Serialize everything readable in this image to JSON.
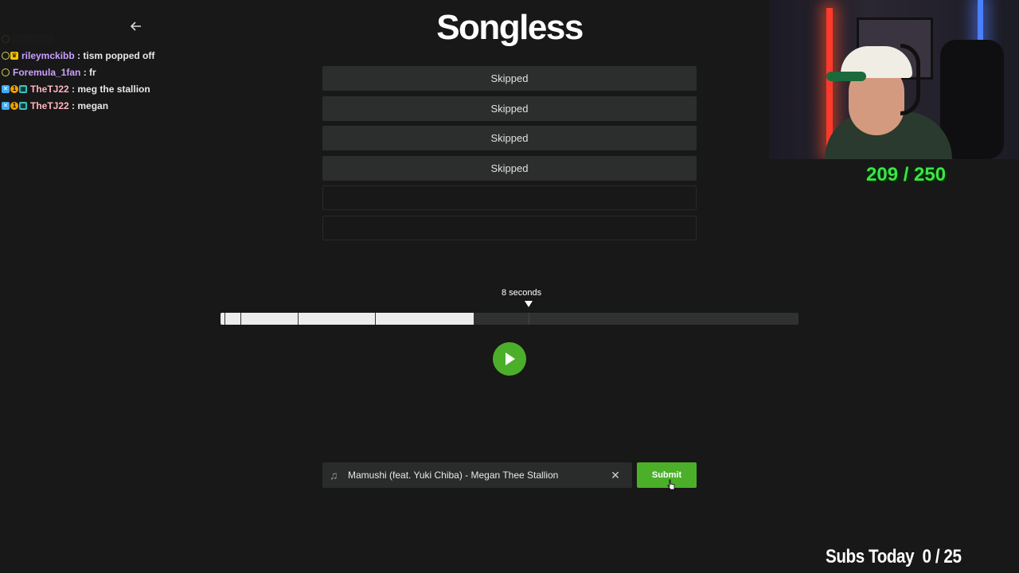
{
  "app": {
    "title": "Songless"
  },
  "chat": {
    "messages": [
      {
        "user": "rileymckibb",
        "text": "tism popped off",
        "user_color": "#c9a0ff"
      },
      {
        "user": "Foremula_1fan",
        "text": "fr",
        "user_color": "#c9a0ff"
      },
      {
        "user": "TheTJ22",
        "text": "meg the stallion",
        "user_color": "#ffb6c1"
      },
      {
        "user": "TheTJ22",
        "text": "megan",
        "user_color": "#ffb6c1"
      }
    ]
  },
  "guesses": [
    {
      "label": "Skipped"
    },
    {
      "label": "Skipped"
    },
    {
      "label": "Skipped"
    },
    {
      "label": "Skipped"
    },
    {
      "label": ""
    },
    {
      "label": ""
    }
  ],
  "player": {
    "time_label": "8 seconds",
    "progress_fraction": 0.438
  },
  "answer": {
    "value": "Mamushi (feat. Yuki Chiba) - Megan Thee Stallion",
    "submit_label": "Submit"
  },
  "overlay": {
    "counter": "209 / 250",
    "subs_label": "Subs Today",
    "subs_value": "0 / 25"
  },
  "colors": {
    "accent": "#4caf2a",
    "background": "#181818",
    "counter": "#3fe24a"
  },
  "icons": {
    "back": "back-arrow-icon",
    "play": "play-icon",
    "note": "music-note-icon",
    "clear": "close-icon"
  }
}
